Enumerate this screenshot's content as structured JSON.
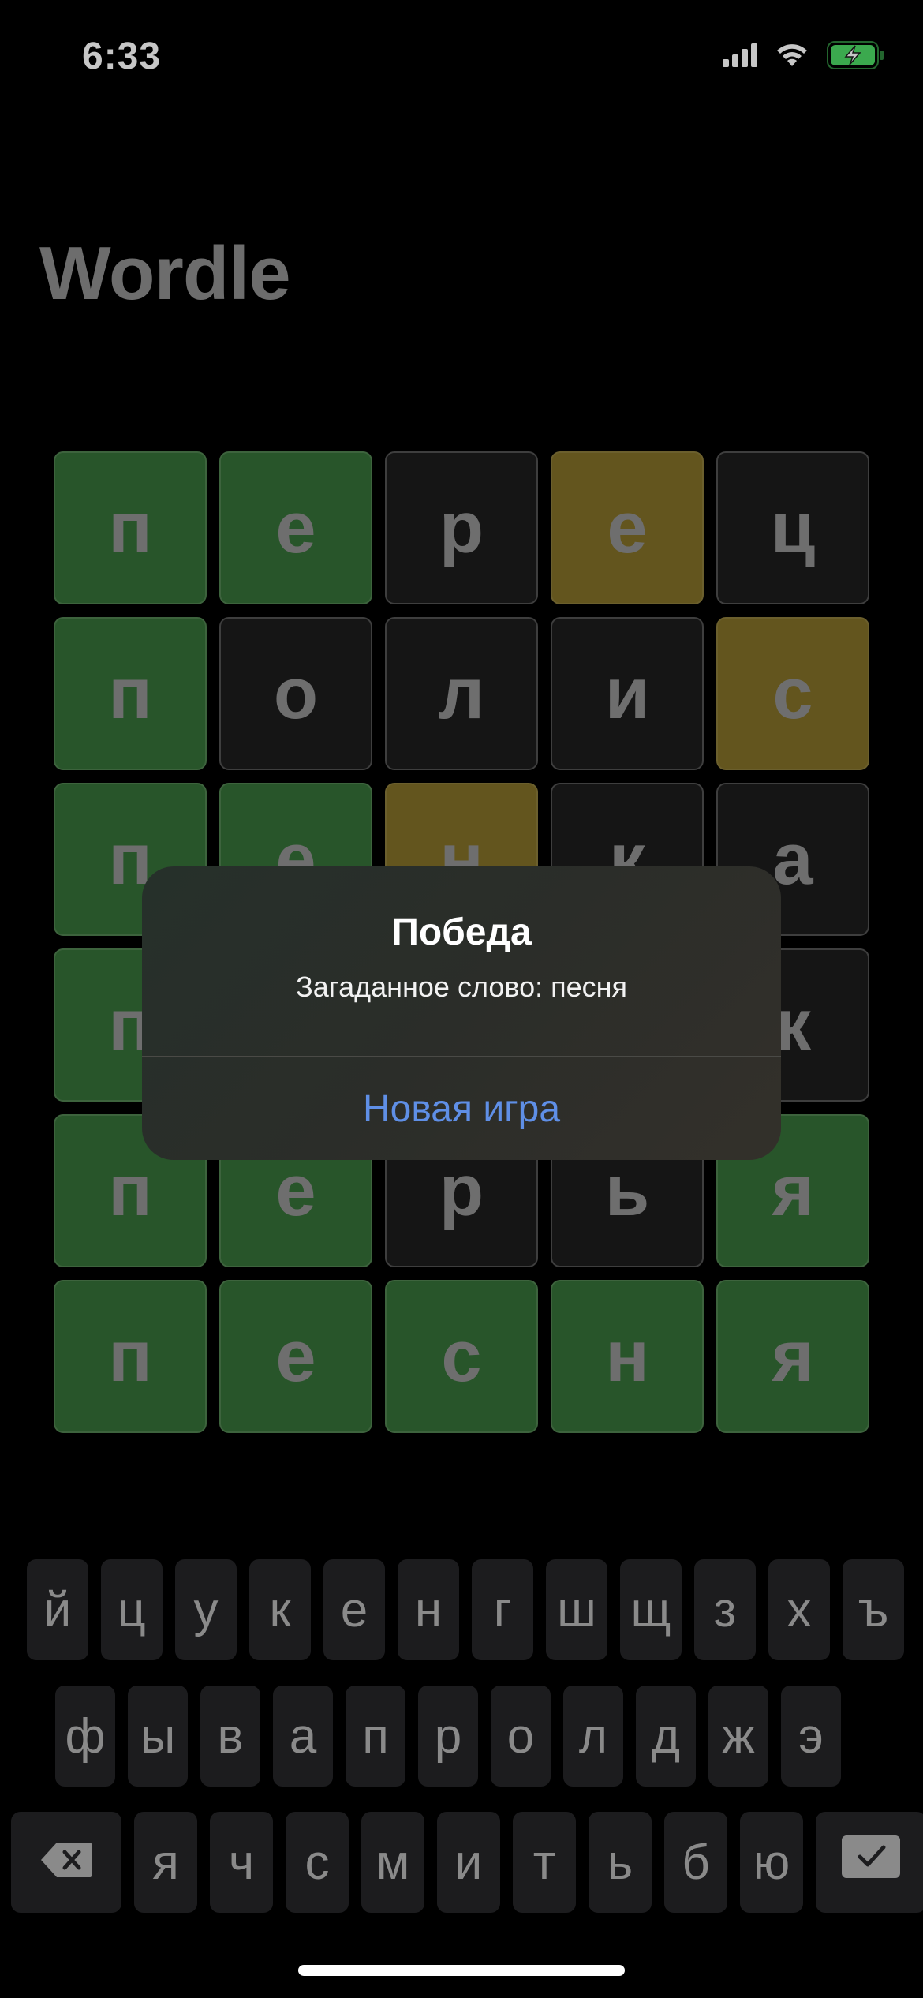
{
  "status_bar": {
    "time": "6:33",
    "icons": [
      "signal-icon",
      "wifi-icon",
      "battery-charging-icon"
    ],
    "battery_color": "#4cd964"
  },
  "app": {
    "title": "Wordle"
  },
  "board": {
    "rows": [
      [
        {
          "letter": "п",
          "state": "correct"
        },
        {
          "letter": "е",
          "state": "correct"
        },
        {
          "letter": "р",
          "state": "absent"
        },
        {
          "letter": "е",
          "state": "present"
        },
        {
          "letter": "ц",
          "state": "absent"
        }
      ],
      [
        {
          "letter": "п",
          "state": "correct"
        },
        {
          "letter": "о",
          "state": "absent"
        },
        {
          "letter": "л",
          "state": "absent"
        },
        {
          "letter": "и",
          "state": "absent"
        },
        {
          "letter": "с",
          "state": "present"
        }
      ],
      [
        {
          "letter": "п",
          "state": "correct"
        },
        {
          "letter": "е",
          "state": "correct"
        },
        {
          "letter": "н",
          "state": "present"
        },
        {
          "letter": "к",
          "state": "absent"
        },
        {
          "letter": "а",
          "state": "absent"
        }
      ],
      [
        {
          "letter": "п",
          "state": "correct"
        },
        {
          "letter": "",
          "state": "hidden"
        },
        {
          "letter": "",
          "state": "hidden"
        },
        {
          "letter": "",
          "state": "hidden"
        },
        {
          "letter": "к",
          "state": "absent"
        }
      ],
      [
        {
          "letter": "п",
          "state": "correct"
        },
        {
          "letter": "е",
          "state": "correct"
        },
        {
          "letter": "р",
          "state": "absent"
        },
        {
          "letter": "ь",
          "state": "absent"
        },
        {
          "letter": "я",
          "state": "correct"
        }
      ],
      [
        {
          "letter": "п",
          "state": "correct"
        },
        {
          "letter": "е",
          "state": "correct"
        },
        {
          "letter": "с",
          "state": "correct"
        },
        {
          "letter": "н",
          "state": "correct"
        },
        {
          "letter": "я",
          "state": "correct"
        }
      ]
    ],
    "colors": {
      "correct": "#346d36",
      "present": "#7f6d27",
      "absent": "#1c1c1c"
    }
  },
  "alert": {
    "title": "Победа",
    "message": "Загаданное слово: песня",
    "button_label": "Новая игра",
    "button_color": "#5f8fe6"
  },
  "keyboard": {
    "row1": [
      "й",
      "ц",
      "у",
      "к",
      "е",
      "н",
      "г",
      "ш",
      "щ",
      "з",
      "х",
      "ъ"
    ],
    "row2": [
      "ф",
      "ы",
      "в",
      "а",
      "п",
      "р",
      "о",
      "л",
      "д",
      "ж",
      "э"
    ],
    "row3": [
      "я",
      "ч",
      "с",
      "м",
      "и",
      "т",
      "ь",
      "б",
      "ю"
    ],
    "delete_icon": "backspace-icon",
    "enter_icon": "checkmark-icon"
  }
}
